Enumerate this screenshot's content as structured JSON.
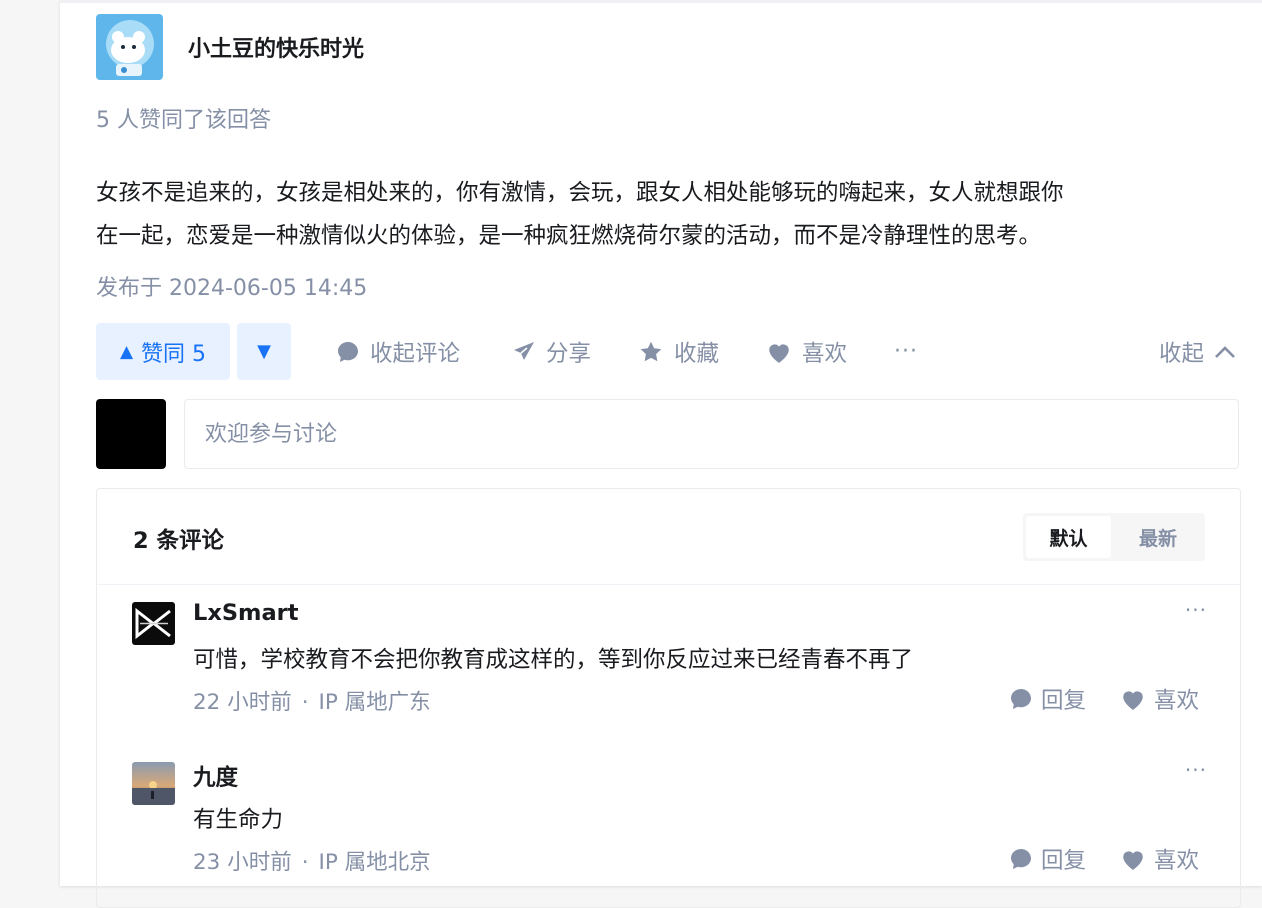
{
  "author": {
    "name": "小土豆的快乐时光",
    "avatar_icon": "cartoon-polar-bear-avatar"
  },
  "vote_summary": "5 人赞同了该回答",
  "answer": {
    "line1": "女孩不是追来的，女孩是相处来的，你有激情，会玩，跟女人相处能够玩的嗨起来，女人就想跟你",
    "line2": "在一起，恋爱是一种激情似火的体验，是一种疯狂燃烧荷尔蒙的活动，而不是冷静理性的思考。",
    "published": "发布于 2024-06-05 14:45"
  },
  "actions": {
    "upvote_label": "赞同 5",
    "collapse_comments": "收起评论",
    "share": "分享",
    "favorite": "收藏",
    "like": "喜欢",
    "more": "···",
    "collapse": "收起"
  },
  "composer": {
    "placeholder": "欢迎参与讨论"
  },
  "comments": {
    "count_label": "2 条评论",
    "sort": {
      "default": "默认",
      "newest": "最新"
    },
    "items": [
      {
        "author": "LxSmart",
        "text": "可惜，学校教育不会把你教育成这样的，等到你反应过来已经青春不再了",
        "time": "22 小时前",
        "ip": "IP 属地广东",
        "reply": "回复",
        "like": "喜欢",
        "more": "···"
      },
      {
        "author": "九度",
        "text": "有生命力",
        "time": "23 小时前",
        "ip": "IP 属地北京",
        "reply": "回复",
        "like": "喜欢",
        "more": "···"
      }
    ]
  },
  "colors": {
    "brand_blue": "#1772f6",
    "brand_blue_bg": "#e8f1ff",
    "muted": "#8590a6",
    "text": "#191b1f"
  }
}
